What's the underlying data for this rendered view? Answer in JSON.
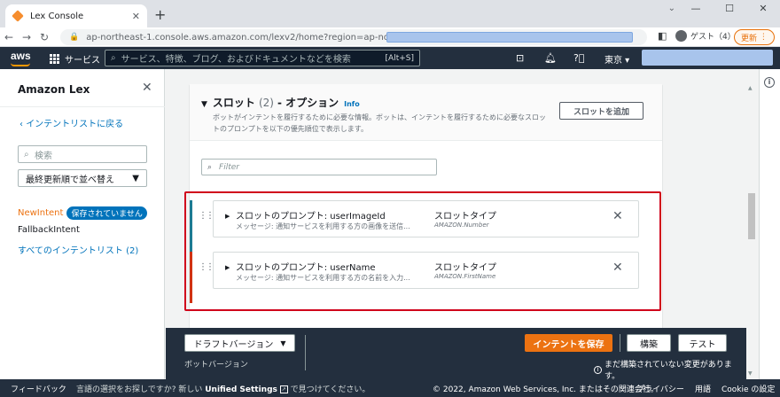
{
  "browser": {
    "tab_title": "Lex Console",
    "tab_close": "✕",
    "new_tab": "+",
    "url": "ap-northeast-1.console.aws.amazon.com/lexv2/home?region=ap-northeast-1#bot/",
    "profile": "ゲスト（4）",
    "update_label": "更新"
  },
  "aws_header": {
    "logo": "aws",
    "services": "サービス",
    "search_placeholder": "サービス、特徴、ブログ、およびドキュメントなどを検索",
    "search_shortcut": "[Alt+S]",
    "region": "東京 ▾"
  },
  "leftnav": {
    "title": "Amazon Lex",
    "back_link": "インテントリストに戻る",
    "search_placeholder": "検索",
    "sort_label": "最終更新順で並べ替え",
    "intents": {
      "new_intent": "NewIntent",
      "unsaved_badge": "保存されていません",
      "fallback": "FallbackIntent",
      "all_link": "すべてのインテントリスト (2)"
    }
  },
  "slots": {
    "title": "スロット",
    "count": "(2)",
    "separator": "- オプション",
    "info": "Info",
    "description": "ボットがインテントを履行するために必要な情報。ボットは、インテントを履行するために必要なスロットのプロンプトを以下の優先順位で表示します。",
    "add_button": "スロットを追加",
    "filter_placeholder": "Filter",
    "rows": [
      {
        "prompt_title": "スロットのプロンプト: userImageId",
        "message": "メッセージ: 通知サービスを利用する方の画像を送信...",
        "type_label": "スロットタイプ",
        "type_value": "AMAZON.Number",
        "bar_color": "#1d7b93"
      },
      {
        "prompt_title": "スロットのプロンプト: userName",
        "message": "メッセージ: 通知サービスを利用する方の名前を入力...",
        "type_label": "スロットタイプ",
        "type_value": "AMAZON.FirstName",
        "bar_color": "#d13212"
      }
    ]
  },
  "actionbar": {
    "draft_version": "ドラフトバージョン",
    "bot_version": "ボットバージョン",
    "save_intent": "インテントを保存",
    "build": "構築",
    "test": "テスト",
    "unbuilt_notice": "まだ構築されていない変更があります。"
  },
  "footer": {
    "feedback": "フィードバック",
    "lang_prefix": "言語の選択をお探しですか? 新しい",
    "lang_link": "Unified Settings",
    "lang_suffix": "で見つけてください。",
    "copyright": "© 2022, Amazon Web Services, Inc. またはその関連会社。",
    "privacy": "プライバシー",
    "terms": "用語",
    "cookie": "Cookie の設定"
  }
}
